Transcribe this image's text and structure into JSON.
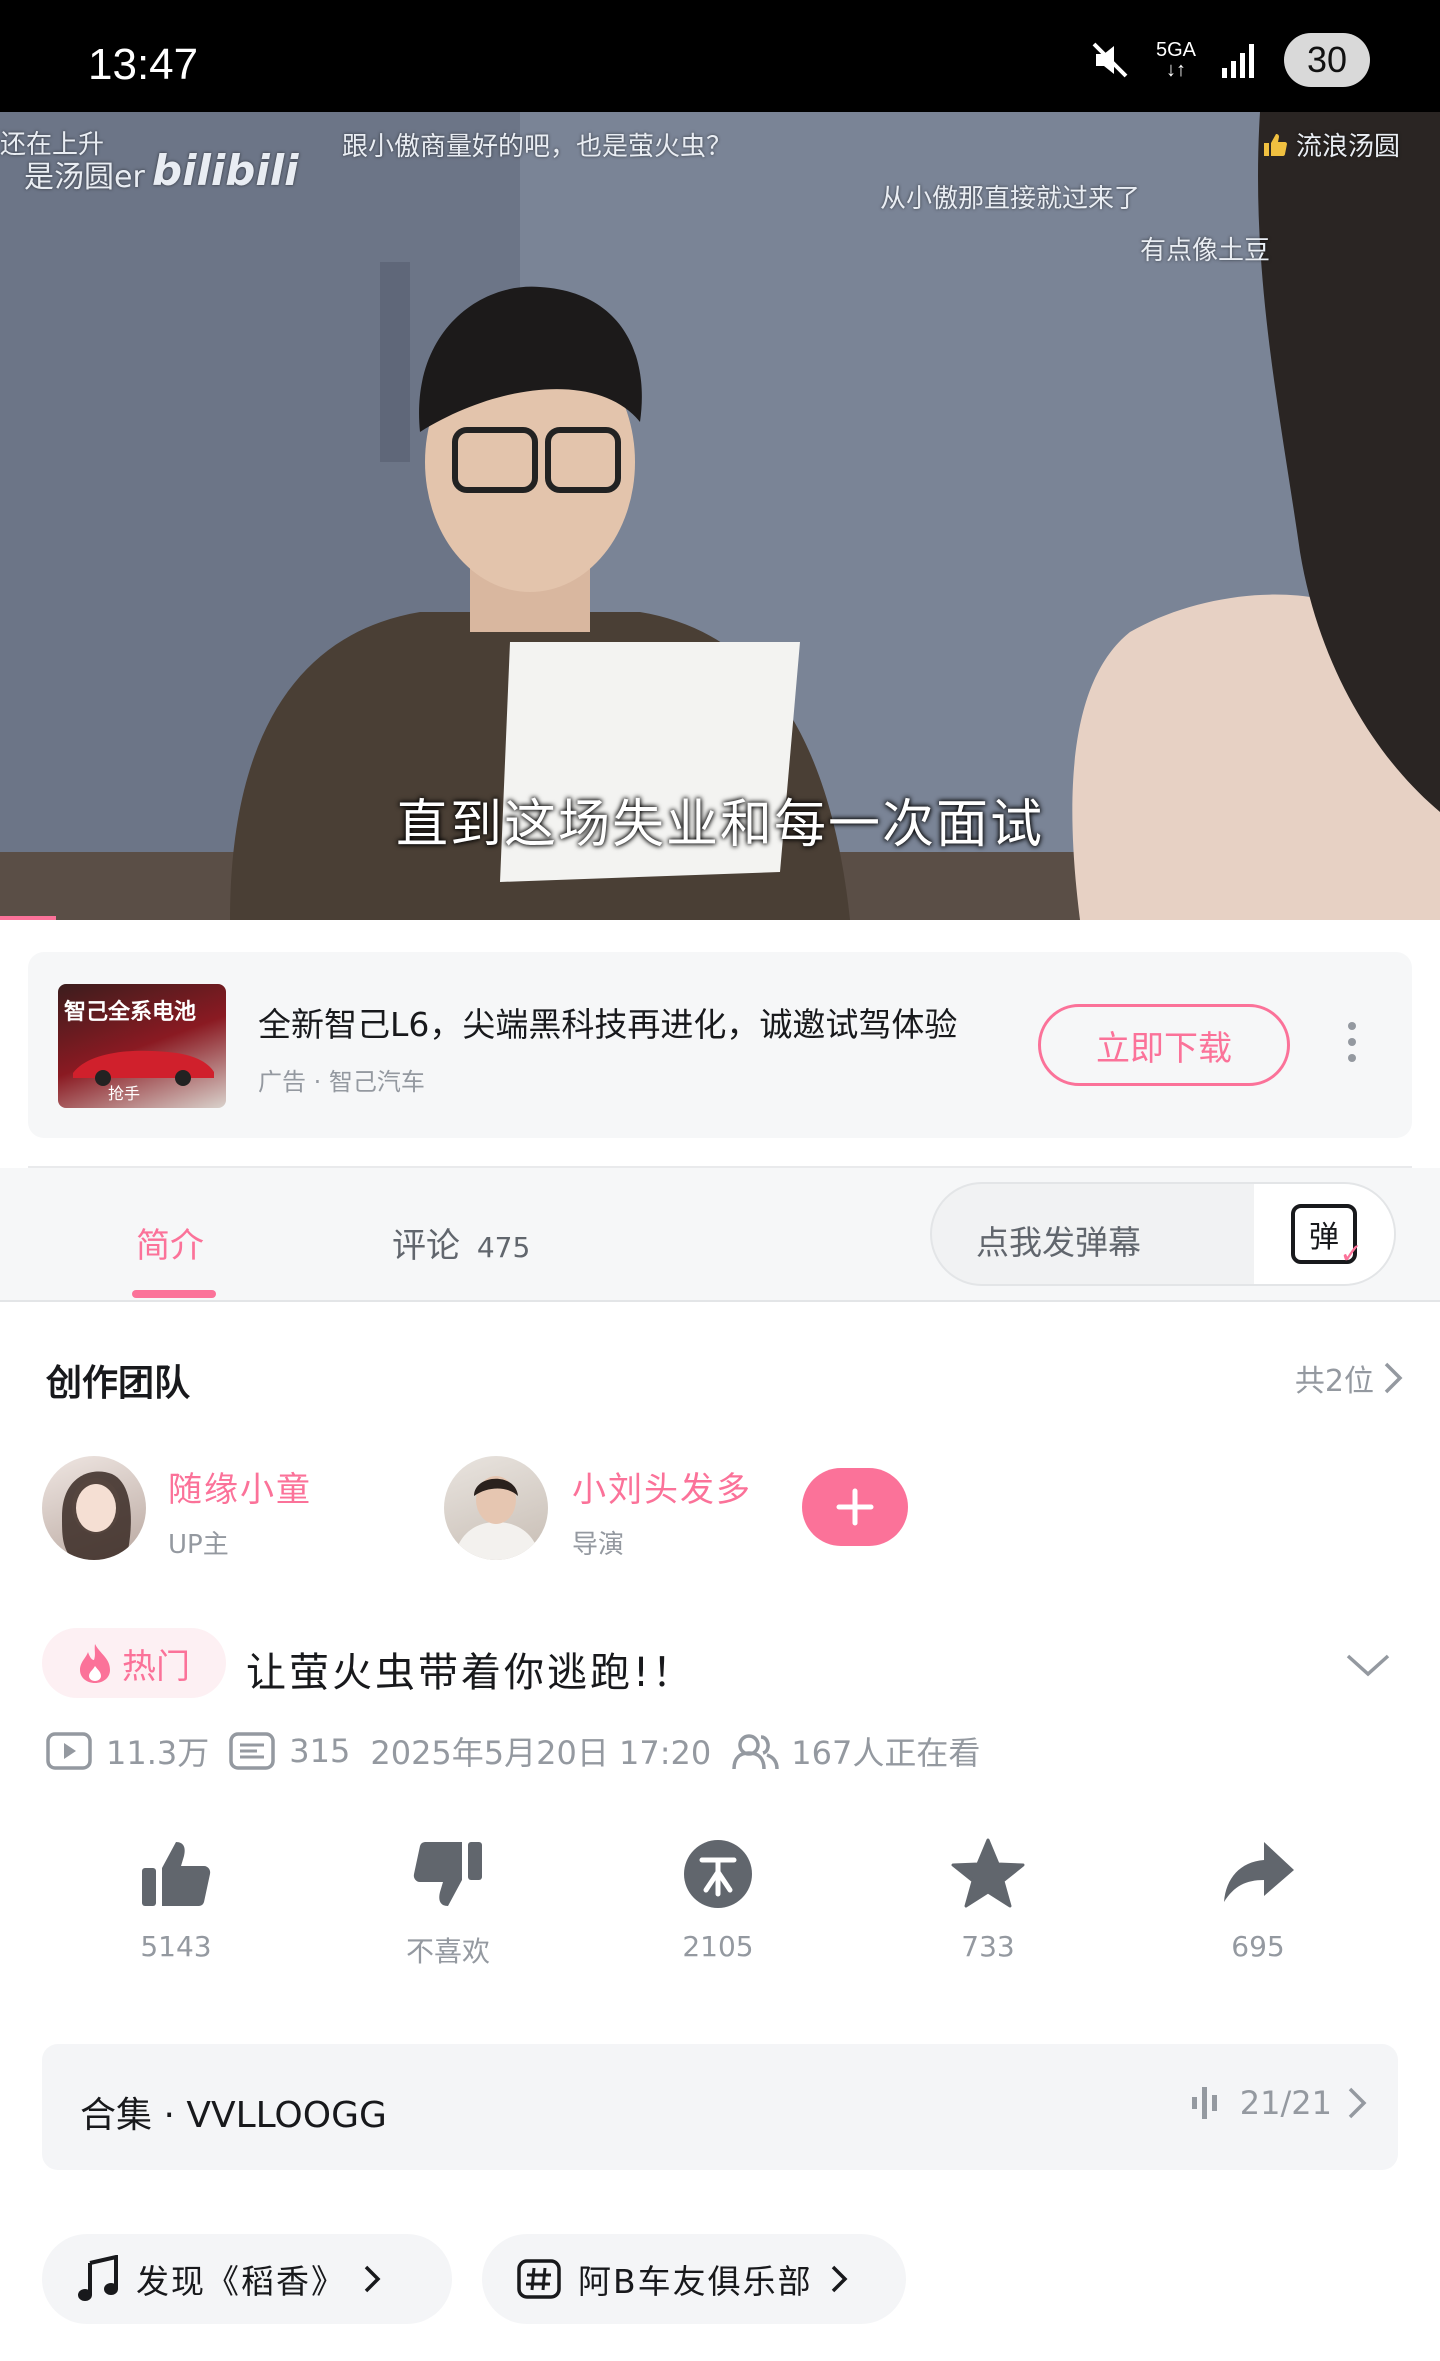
{
  "status_bar": {
    "time": "13:47",
    "network": "5GA",
    "battery": "30"
  },
  "video": {
    "watermark": "是汤圆er",
    "platform_logo": "bilibili",
    "uploader_overlay": "流浪汤圆",
    "danmaku": [
      "还在上升",
      "跟小傲商量好的吧，也是萤火虫？",
      "从小傲那直接就过来了",
      "有点像土豆"
    ],
    "subtitle": "直到这场失业和每一次面试",
    "progress": 0.04
  },
  "ad": {
    "thumb_text": "智己全系电池",
    "thumb_sub": "抢手",
    "title": "全新智己L6，尖端黑科技再进化，诚邀试驾体验",
    "sub": "广告 · 智己汽车",
    "button": "立即下载"
  },
  "tabs": {
    "intro": "简介",
    "comments": "评论",
    "comments_count": "475",
    "danmaku_placeholder": "点我发弹幕",
    "danmaku_button": "弹"
  },
  "team": {
    "title": "创作团队",
    "count": "共2位",
    "members": [
      {
        "name": "随缘小童",
        "role": "UP主"
      },
      {
        "name": "小刘头发多",
        "role": "导演"
      }
    ]
  },
  "video_info": {
    "hot_badge": "热门",
    "title": "让萤火虫带着你逃跑!！",
    "views": "11.3万",
    "danmaku_count": "315",
    "date": "2025年5月20日 17:20",
    "watching": "167人正在看"
  },
  "actions": [
    {
      "icon": "thumbs-up-icon",
      "label": "5143"
    },
    {
      "icon": "thumbs-down-icon",
      "label": "不喜欢"
    },
    {
      "icon": "coin-icon",
      "label": "2105"
    },
    {
      "icon": "star-icon",
      "label": "733"
    },
    {
      "icon": "share-icon",
      "label": "695"
    }
  ],
  "collection": {
    "title": "合集 · VVLLOOGG",
    "progress": "21/21"
  },
  "tags": [
    {
      "icon": "music-note-icon",
      "label": "发现《稻香》"
    },
    {
      "icon": "hashtag-icon",
      "label": "阿B车友俱乐部"
    }
  ],
  "colors": {
    "accent": "#fb7299",
    "secondary_text": "#9499a0"
  }
}
